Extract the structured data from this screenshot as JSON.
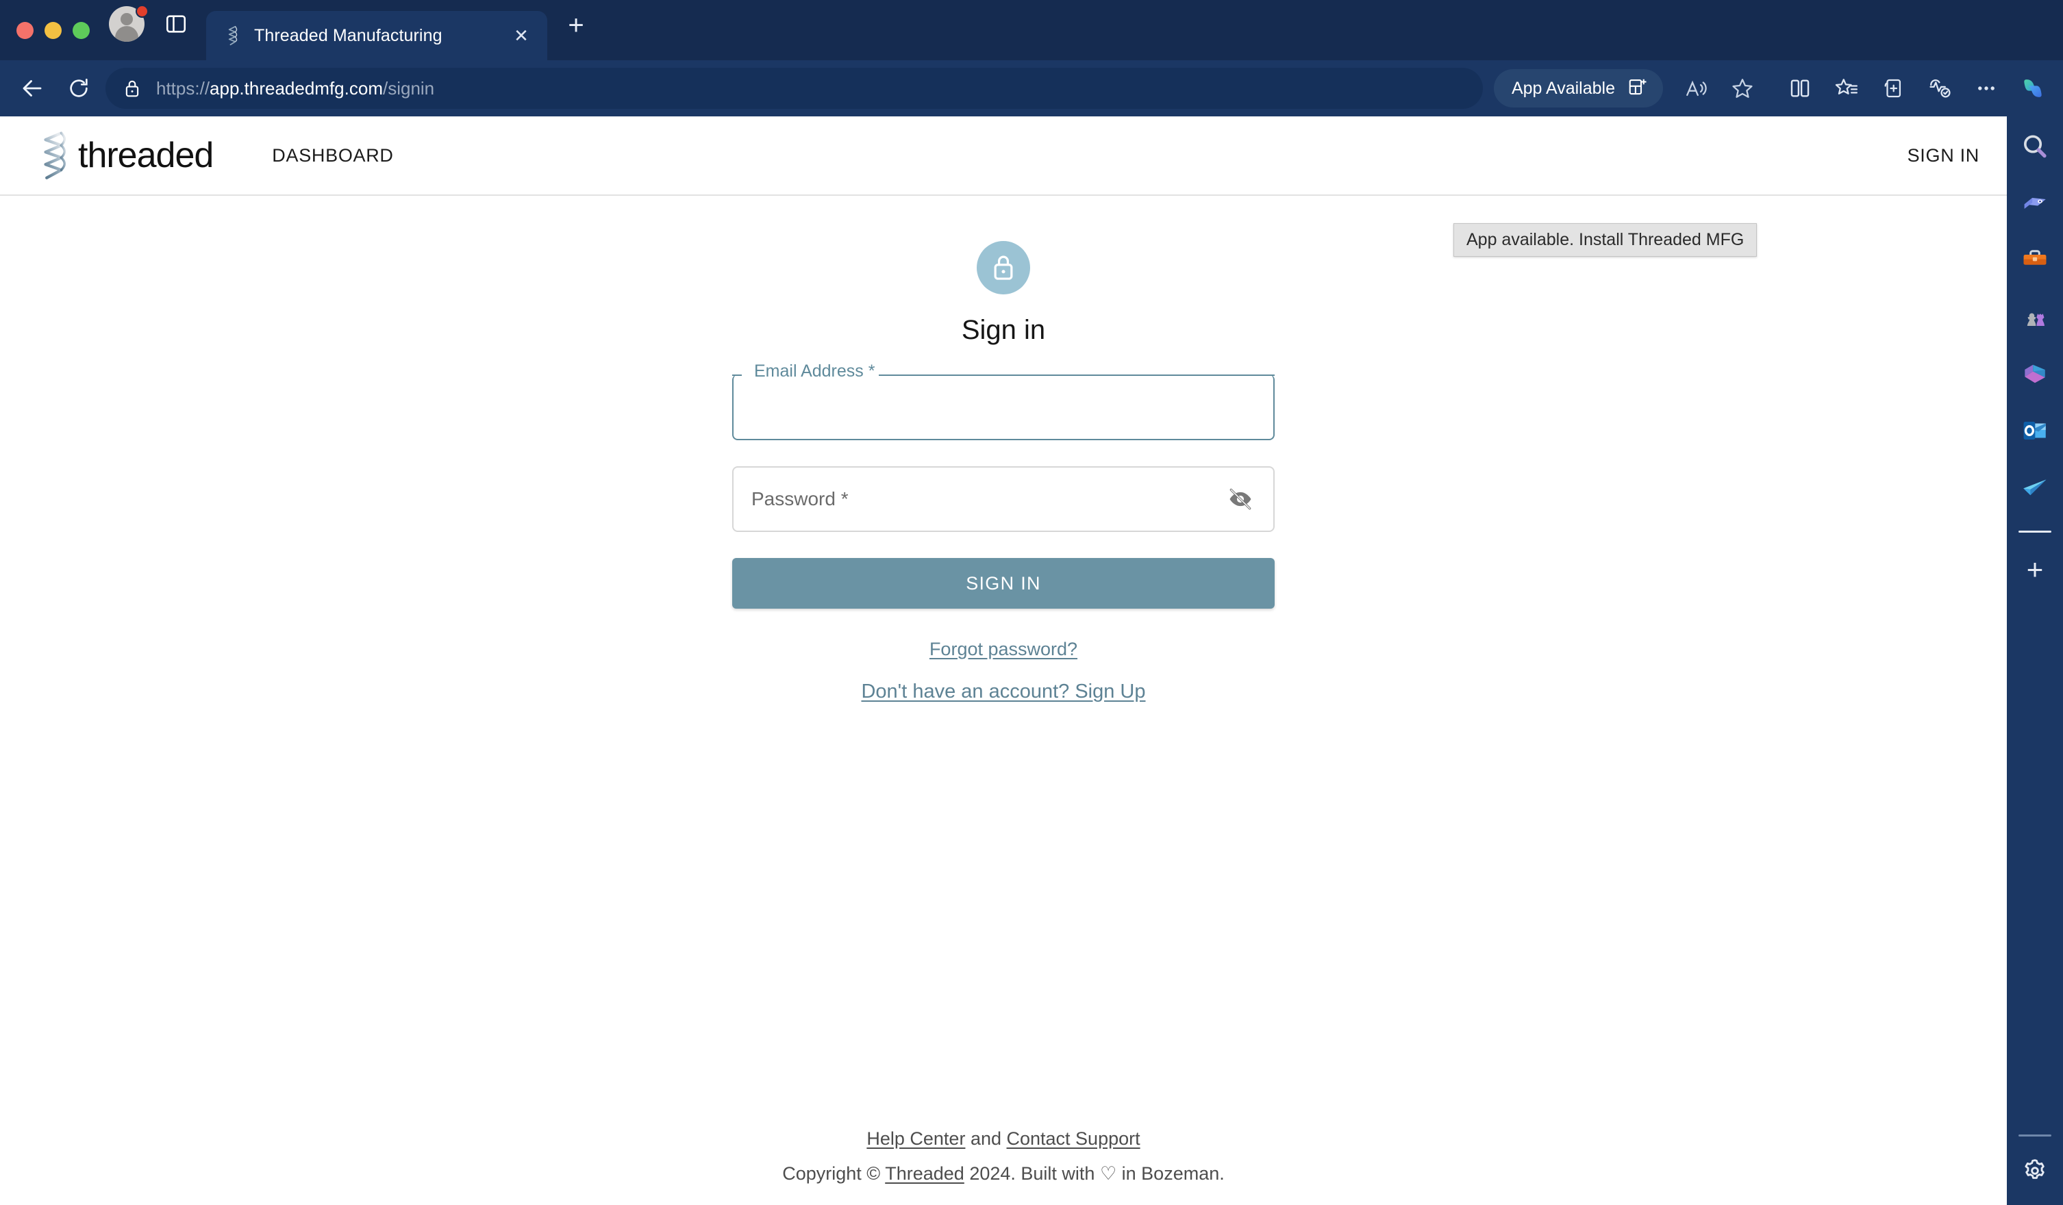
{
  "browser": {
    "traffic_lights": [
      "close",
      "minimize",
      "maximize"
    ],
    "profile": {
      "name": "profile-avatar",
      "badge": "1"
    },
    "split_view_label": "split-screen-icon",
    "tab": {
      "title": "Threaded Manufacturing",
      "favicon": "threaded-logo-icon",
      "close_label": "✕"
    },
    "new_tab_label": "+",
    "nav": {
      "back_label": "back-arrow-icon",
      "reload_label": "reload-icon"
    },
    "omnibox": {
      "lock_icon": "site-lock-icon",
      "url_scheme": "https://",
      "url_host": "app.threadedmfg.com",
      "url_path": "/signin",
      "full_url": "https://app.threadedmfg.com/signin"
    },
    "app_pill": {
      "label": "App Available",
      "icon": "install-app-icon"
    },
    "toolbar_icons": [
      "read-aloud-icon",
      "add-favorite-icon",
      "split-screen-icon",
      "favorites-icon",
      "collections-icon",
      "browser-essentials-icon",
      "settings-and-more-icon",
      "copilot-icon"
    ],
    "tooltip": {
      "text": "App available. Install Threaded MFG"
    },
    "sidebar": {
      "items": [
        "search-icon",
        "shopping-tag-icon",
        "tools-icon",
        "games-icon",
        "microsoft-365-icon",
        "outlook-icon",
        "send-icon"
      ],
      "add_label": "+",
      "settings_icon": "gear-icon"
    }
  },
  "app": {
    "header": {
      "brand_name": "threaded",
      "brand_mark": "threaded-zigzag-logo",
      "nav_label": "DASHBOARD",
      "signin_label": "SIGN IN"
    },
    "signin": {
      "lock_icon": "lock-icon",
      "title": "Sign in",
      "email": {
        "label": "Email Address *",
        "value": "",
        "placeholder": ""
      },
      "password": {
        "label": "Password *",
        "value": "",
        "toggle_icon": "eye-off-icon"
      },
      "submit_label": "SIGN IN",
      "forgot_label": "Forgot password?",
      "signup_label": "Don't have an account? Sign Up"
    },
    "footer": {
      "help_label": "Help Center",
      "and_label": " and ",
      "contact_label": "Contact Support",
      "copyright_prefix": "Copyright © ",
      "company_label": "Threaded",
      "copyright_mid": " 2024. Built with ",
      "heart": "♡",
      "copyright_suffix": " in Bozeman."
    }
  },
  "colors": {
    "browser_chrome": "#1b3764",
    "tabstrip": "#152b50",
    "omnibox": "#15305a",
    "accent": "#6a93a4",
    "field_focus": "#5f8a9b",
    "lock_avatar": "#9bc3d4",
    "link": "#5d8294"
  }
}
